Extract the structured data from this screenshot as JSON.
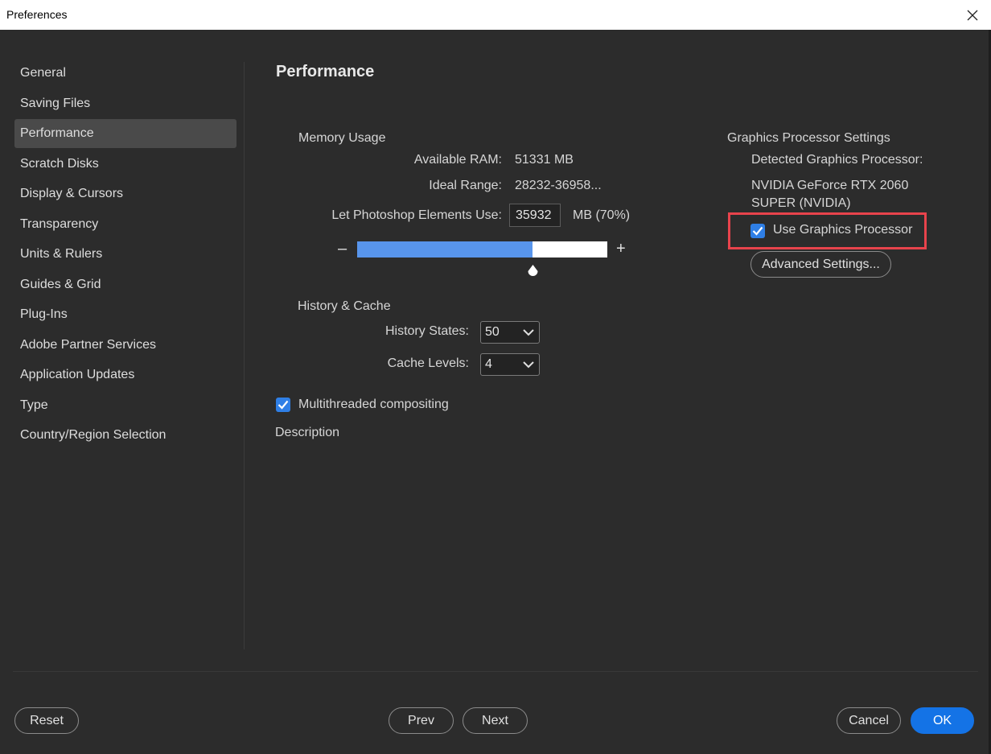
{
  "window": {
    "title": "Preferences"
  },
  "sidebar": {
    "items": [
      {
        "label": "General"
      },
      {
        "label": "Saving Files"
      },
      {
        "label": "Performance",
        "selected": true
      },
      {
        "label": "Scratch Disks"
      },
      {
        "label": "Display & Cursors"
      },
      {
        "label": "Transparency"
      },
      {
        "label": "Units & Rulers"
      },
      {
        "label": "Guides & Grid"
      },
      {
        "label": "Plug-Ins"
      },
      {
        "label": "Adobe Partner Services"
      },
      {
        "label": "Application Updates"
      },
      {
        "label": "Type"
      },
      {
        "label": "Country/Region Selection"
      }
    ]
  },
  "main": {
    "title": "Performance",
    "memory": {
      "heading": "Memory Usage",
      "available_label": "Available RAM:",
      "available_value": "51331 MB",
      "ideal_label": "Ideal Range:",
      "ideal_value": "28232-36958...",
      "use_label": "Let Photoshop Elements Use:",
      "use_value": "35932",
      "use_unit": "MB (70%)",
      "slider_fraction": 0.7,
      "minus": "–",
      "plus": "+"
    },
    "history": {
      "heading": "History & Cache",
      "states_label": "History States:",
      "states_value": "50",
      "cache_label": "Cache Levels:",
      "cache_value": "4"
    },
    "multithreaded": {
      "label": "Multithreaded compositing",
      "checked": true
    },
    "description_label": "Description",
    "gpu": {
      "heading": "Graphics Processor Settings",
      "detected_label": "Detected Graphics Processor:",
      "name_line1": "NVIDIA GeForce RTX 2060",
      "name_line2": "SUPER (NVIDIA)",
      "use_gpu_label": "Use Graphics Processor",
      "use_gpu_checked": true,
      "advanced_button": "Advanced Settings..."
    }
  },
  "footer": {
    "reset": "Reset",
    "prev": "Prev",
    "next": "Next",
    "cancel": "Cancel",
    "ok": "OK"
  },
  "colors": {
    "background": "#2c2c2c",
    "accent": "#1473e6",
    "slider_fill": "#5895ec",
    "highlight": "#e8434c"
  }
}
